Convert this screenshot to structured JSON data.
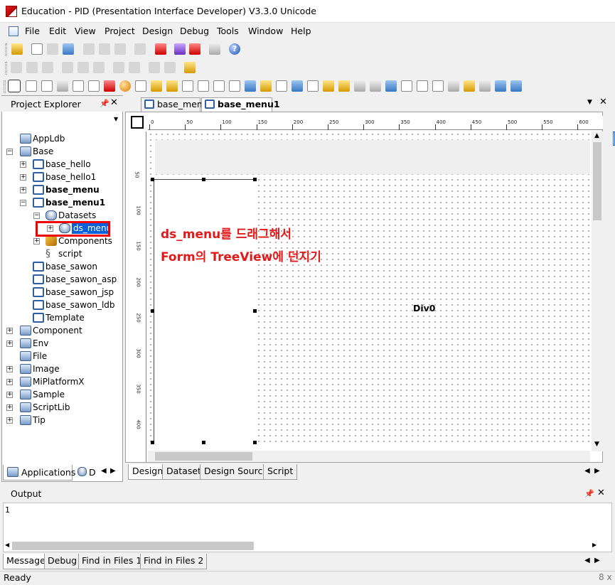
{
  "window": {
    "title": "Education - PID (Presentation Interface Developer) V3.3.0 Unicode"
  },
  "menu": [
    "File",
    "Edit",
    "View",
    "Project",
    "Design",
    "Debug",
    "Tools",
    "Window",
    "Help"
  ],
  "project_explorer": {
    "title": "Project Explorer",
    "tree": [
      {
        "label": "AppLdb",
        "icon": "project-icon"
      },
      {
        "label": "Base",
        "icon": "project-icon",
        "expanded": true
      },
      {
        "label": "base_hello",
        "icon": "form-icon"
      },
      {
        "label": "base_hello1",
        "icon": "form-icon"
      },
      {
        "label": "base_menu",
        "icon": "form-icon",
        "bold": true
      },
      {
        "label": "base_menu1",
        "icon": "form-icon",
        "bold": true,
        "expanded": true
      },
      {
        "label": "Datasets",
        "icon": "datasets-icon",
        "expanded": true
      },
      {
        "label": "ds_menu",
        "icon": "dataset-icon",
        "selected": true
      },
      {
        "label": "Components",
        "icon": "components-icon"
      },
      {
        "label": "script",
        "icon": "script-icon"
      },
      {
        "label": "base_sawon",
        "icon": "form-icon"
      },
      {
        "label": "base_sawon_asp",
        "icon": "form-icon"
      },
      {
        "label": "base_sawon_jsp",
        "icon": "form-icon"
      },
      {
        "label": "base_sawon_ldb",
        "icon": "form-icon"
      },
      {
        "label": "Template",
        "icon": "form-icon"
      },
      {
        "label": "Component",
        "icon": "project-icon"
      },
      {
        "label": "Env",
        "icon": "project-icon"
      },
      {
        "label": "File",
        "icon": "project-icon"
      },
      {
        "label": "Image",
        "icon": "project-icon"
      },
      {
        "label": "MiPlatformX",
        "icon": "project-icon"
      },
      {
        "label": "Sample",
        "icon": "project-icon"
      },
      {
        "label": "ScriptLib",
        "icon": "project-icon"
      },
      {
        "label": "Tip",
        "icon": "project-icon"
      }
    ],
    "bottom_tabs": {
      "applications": "Applications",
      "db": "D"
    }
  },
  "document_tabs": [
    "base_menu",
    "base_menu1"
  ],
  "ruler": {
    "top": [
      "0",
      "50",
      "100",
      "150",
      "200",
      "250",
      "300",
      "350",
      "400",
      "450",
      "500",
      "550",
      "600"
    ],
    "left": [
      "50",
      "100",
      "150",
      "200",
      "250",
      "300",
      "350",
      "400"
    ]
  },
  "canvas": {
    "div_label": "Div0",
    "annotation_line1": "ds_menu를 드래그해서",
    "annotation_line2": "Form의 TreeView에 던지기"
  },
  "design_tabs": [
    "Design",
    "Dataset",
    "Design Source",
    "Script"
  ],
  "output": {
    "title": "Output",
    "line_number": "1",
    "tabs": [
      "Message",
      "Debug",
      "Find in Files 1",
      "Find in Files 2"
    ]
  },
  "status": {
    "text": "Ready",
    "right": "8 x"
  },
  "colors": {
    "annotation": "#e01a1a",
    "selection": "#0a60d8",
    "highlight_box": "#e00000"
  }
}
